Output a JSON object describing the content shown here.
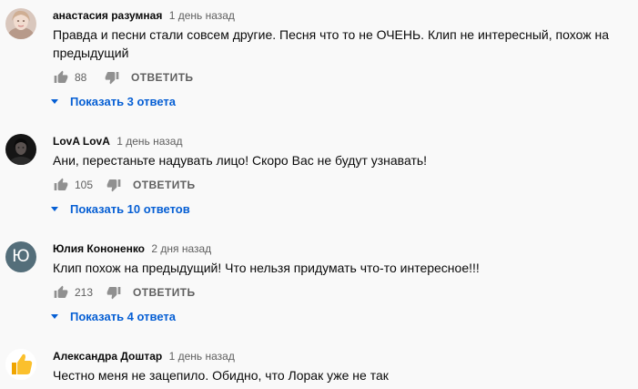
{
  "comments": [
    {
      "author": "анастасия разумная",
      "time": "1 день назад",
      "text": "Правда и песни стали совсем другие. Песня что то не ОЧЕНЬ. Клип не интересный, похож на предыдущий",
      "likes": "88",
      "reply_label": "ОТВЕТИТЬ",
      "replies_label": "Показать 3 ответа",
      "avatar": "photo-avatar"
    },
    {
      "author": "LovA LovA",
      "time": "1 день назад",
      "text": "Ани, перестаньте надувать лицо! Скоро Вас не будут узнавать!",
      "likes": "105",
      "reply_label": "ОТВЕТИТЬ",
      "replies_label": "Показать 10 ответов",
      "avatar": "photo-avatar-dark"
    },
    {
      "author": "Юлия Кононенко",
      "time": "2 дня назад",
      "text": "Клип похож на предыдущий! Что нельзя придумать что-то интересное!!!",
      "likes": "213",
      "reply_label": "ОТВЕТИТЬ",
      "replies_label": "Показать 4 ответа",
      "avatar_letter": "Ю",
      "avatar_color": "#546e7a"
    },
    {
      "author": "Александра Доштар",
      "time": "1 день назад",
      "text": "Честно меня не зацепило. Обидно, что Лорак уже не так",
      "avatar": "thumbs-up-avatar"
    }
  ],
  "colors": {
    "link": "#065fd4",
    "secondary_text": "#606060",
    "icon": "#909090",
    "background": "#f9f9f9"
  }
}
